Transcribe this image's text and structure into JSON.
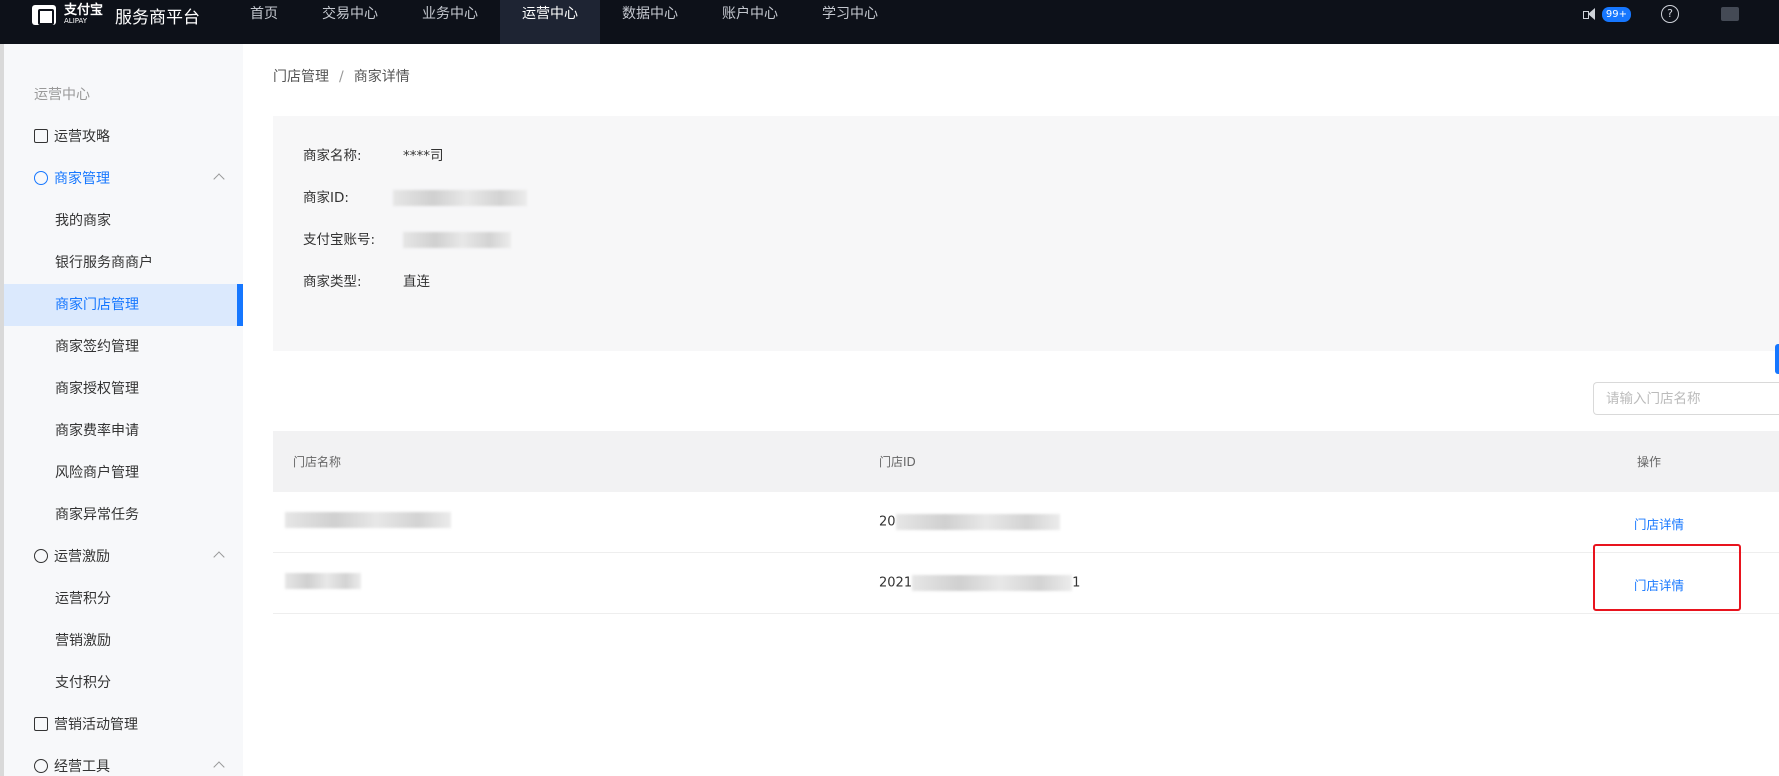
{
  "header": {
    "logo_cn": "支付宝",
    "logo_en": "ALIPAY",
    "platform_name": "服务商平台",
    "nav": [
      "首页",
      "交易中心",
      "业务中心",
      "运营中心",
      "数据中心",
      "账户中心",
      "学习中心"
    ],
    "notification_count": "99+",
    "help": "?"
  },
  "sidebar": {
    "heading": "运营中心",
    "groups": {
      "guide": "运营攻略",
      "merchant_mgmt": "商家管理",
      "incentive": "运营激励",
      "marketing": "营销活动管理",
      "tools": "经营工具"
    },
    "merchant_items": [
      "我的商家",
      "银行服务商商户",
      "商家门店管理",
      "商家签约管理",
      "商家授权管理",
      "商家费率申请",
      "风险商户管理",
      "商家异常任务"
    ],
    "incentive_items": [
      "运营积分",
      "营销激励",
      "支付积分"
    ]
  },
  "breadcrumb": {
    "parent": "门店管理",
    "separator": "/",
    "current": "商家详情"
  },
  "merchant_info": {
    "name_label": "商家名称:",
    "name_value": "****司",
    "id_label": "商家ID:",
    "account_label": "支付宝账号:",
    "type_label": "商家类型:",
    "type_value": "直连"
  },
  "search": {
    "placeholder": "请输入门店名称"
  },
  "table": {
    "columns": [
      "门店名称",
      "门店ID",
      "操作"
    ],
    "rows": [
      {
        "store_id_prefix": "20",
        "store_id_suffix": "",
        "action": "门店详情"
      },
      {
        "store_id_prefix": "2021",
        "store_id_suffix": "1",
        "action": "门店详情"
      }
    ]
  },
  "colors": {
    "accent": "#1677ff",
    "topbar": "#0d1119",
    "highlight": "#e8141e"
  }
}
